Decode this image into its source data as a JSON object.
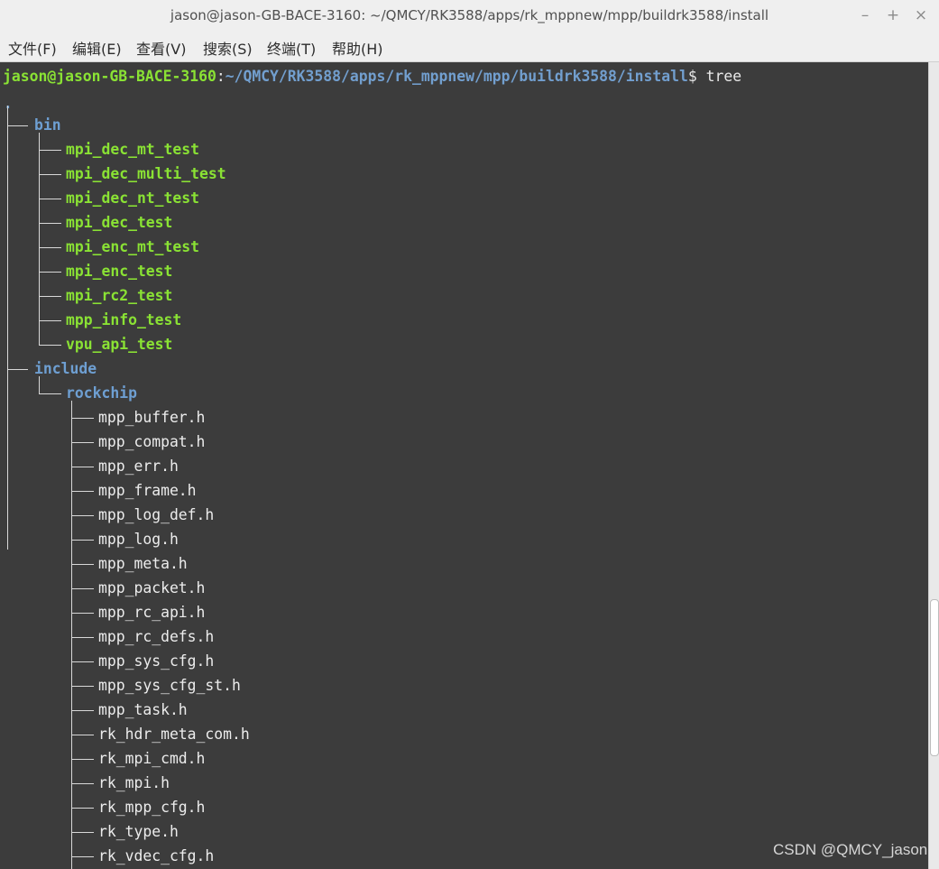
{
  "window": {
    "title": "jason@jason-GB-BACE-3160: ~/QMCY/RK3588/apps/rk_mppnew/mpp/buildrk3588/install",
    "minimize_glyph": "–",
    "maximize_glyph": "+",
    "close_glyph": "×"
  },
  "menu": {
    "items": [
      {
        "label": "文件(F)"
      },
      {
        "label": "编辑(E)"
      },
      {
        "label": "查看(V)"
      },
      {
        "label": "搜索(S)"
      },
      {
        "label": "终端(T)"
      },
      {
        "label": "帮助(H)"
      }
    ]
  },
  "terminal": {
    "prompt_user": "jason@jason-GB-BACE-3160",
    "prompt_colon": ":",
    "prompt_path": "~/QMCY/RK3588/apps/rk_mppnew/mpp/buildrk3588/install",
    "prompt_suffix": "$ tree",
    "root_dot": ".",
    "tree": {
      "bin": {
        "name": "bin",
        "entries": [
          "mpi_dec_mt_test",
          "mpi_dec_multi_test",
          "mpi_dec_nt_test",
          "mpi_dec_test",
          "mpi_enc_mt_test",
          "mpi_enc_test",
          "mpi_rc2_test",
          "mpp_info_test",
          "vpu_api_test"
        ]
      },
      "include": {
        "name": "include",
        "sub": {
          "name": "rockchip",
          "entries": [
            "mpp_buffer.h",
            "mpp_compat.h",
            "mpp_err.h",
            "mpp_frame.h",
            "mpp_log_def.h",
            "mpp_log.h",
            "mpp_meta.h",
            "mpp_packet.h",
            "mpp_rc_api.h",
            "mpp_rc_defs.h",
            "mpp_sys_cfg.h",
            "mpp_sys_cfg_st.h",
            "mpp_task.h",
            "rk_hdr_meta_com.h",
            "rk_mpi_cmd.h",
            "rk_mpi.h",
            "rk_mpp_cfg.h",
            "rk_type.h",
            "rk_vdec_cfg.h"
          ]
        }
      }
    }
  },
  "watermark": "CSDN @QMCY_jason",
  "colors": {
    "prompt_user": "#8ae234",
    "prompt_path": "#729fcf",
    "directory": "#6e9fd2",
    "executable": "#8ae234",
    "file": "#ececec",
    "background": "#3c3c3c"
  }
}
